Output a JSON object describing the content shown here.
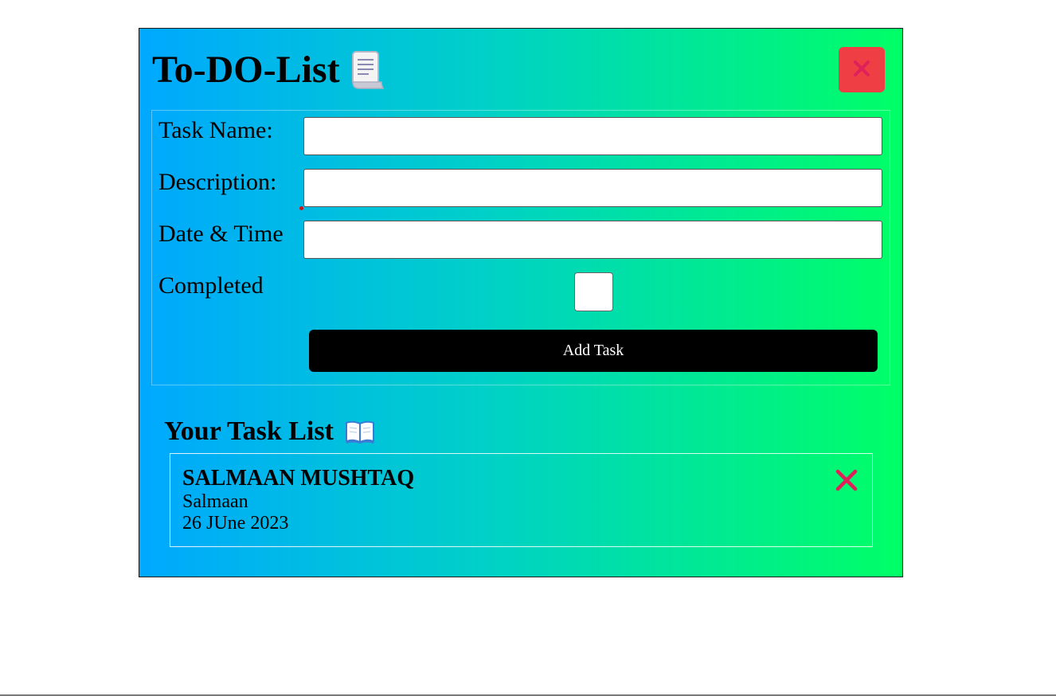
{
  "app": {
    "title": "To-DO-List",
    "title_icon": "scroll-icon",
    "close_icon": "close-icon",
    "accent_close": "#ef3e44",
    "gradient_start": "#00a8ff",
    "gradient_end": "#00ff66"
  },
  "form": {
    "task_name_label": "Task Name:",
    "task_name_value": "",
    "description_label": "Description:",
    "description_value": "",
    "datetime_label": "Date & Time",
    "datetime_value": "",
    "completed_label": "Completed",
    "completed_checked": false,
    "add_button_label": "Add Task"
  },
  "task_list": {
    "title": "Your Task List",
    "title_icon": "open-book-icon",
    "tasks": [
      {
        "name": "SALMAAN MUSHTAQ",
        "description": "Salmaan",
        "date": "26 JUne 2023",
        "delete_icon": "delete-x-icon"
      }
    ]
  }
}
